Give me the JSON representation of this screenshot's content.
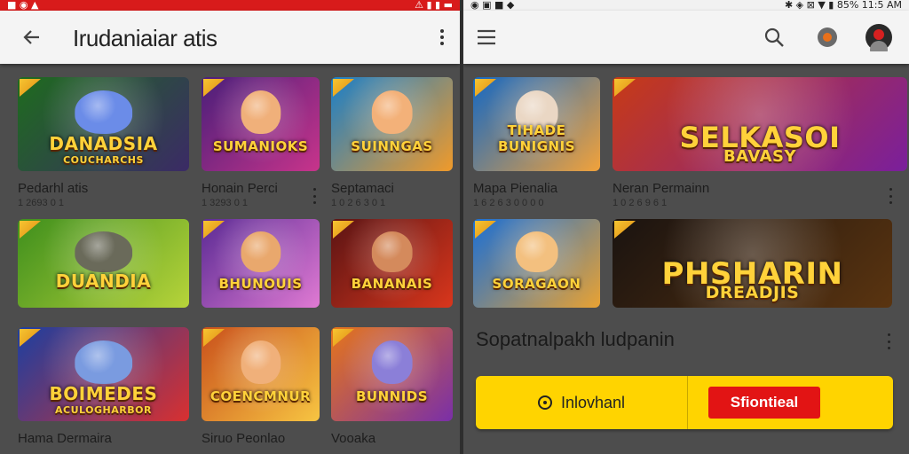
{
  "left_pane": {
    "status_bar": {
      "left": "■ ◉ ▲",
      "right": "⚠ ▮ ▮ ▬"
    },
    "app_bar": {
      "title": "Irudaniaiar atis",
      "back_icon": "arrow-left-icon",
      "more_icon": "more-vert-icon"
    },
    "grid": [
      {
        "logo": "DANADSIA",
        "tagline": "COUCHARCHS",
        "title": "Pedarhl atis",
        "sub": "1 2693 0 1",
        "colors": [
          "#1e6b1e",
          "#3b2a66"
        ],
        "face": "#6b8ce8"
      },
      {
        "logo": "SUMANIOKS",
        "title": "Honain Perci",
        "sub": "1 3293 0 1",
        "colors": [
          "#4a1f7a",
          "#c8348b"
        ],
        "face": "#f0b07a"
      },
      {
        "logo": "SUINNGAS",
        "title": "Septamaci",
        "sub": "1 0 2 6 3 0 1",
        "colors": [
          "#1a7fc9",
          "#f09a2a"
        ],
        "face": "#f3b179"
      },
      {
        "logo": "DUANDIA",
        "title": "",
        "sub": "",
        "colors": [
          "#3f8f1d",
          "#b7d43a"
        ],
        "face": "#6a6a5a"
      },
      {
        "logo": "BHUNOUIS",
        "title": "",
        "sub": "",
        "colors": [
          "#5b2b94",
          "#e07ad3"
        ],
        "face": "#e9a86d"
      },
      {
        "logo": "BANANAIS",
        "title": "",
        "sub": "",
        "colors": [
          "#5a1414",
          "#d9361c"
        ],
        "face": "#d48a5c"
      },
      {
        "logo": "BOIMEDES",
        "tagline": "ACULOGHARBOR",
        "title": "Hama Dermaira",
        "sub": "",
        "colors": [
          "#1c3fa0",
          "#d93030"
        ],
        "face": "#7a9be0"
      },
      {
        "logo": "COENCMNUR",
        "title": "Siruo Peonlao",
        "sub": "",
        "colors": [
          "#c9501c",
          "#f7c542"
        ],
        "face": "#f0b07a"
      },
      {
        "logo": "BUNNIDS",
        "title": "Vooaka",
        "sub": "",
        "colors": [
          "#e6761a",
          "#7a2fa8"
        ],
        "face": "#8b7fd8"
      }
    ]
  },
  "right_pane": {
    "status_bar": {
      "left": "◉ ▣ ■ ◆",
      "right": "✱ ◈ ⊠ ▼ ▮ 85% 11:5 AM"
    },
    "app_bar": {
      "menu_icon": "menu-icon",
      "search_icon": "search-icon",
      "notification_icon": "notification-icon",
      "avatar_icon": "avatar-icon"
    },
    "grid": [
      {
        "logo": "TIHADE BUNIGNIS",
        "title": "Mapa Pienalia",
        "sub": "1 6 2 6 3 0 0 0 0",
        "colors": [
          "#1468c4",
          "#f2a23a"
        ],
        "face": "#ead7c4"
      },
      {
        "logo": "SELKASOI",
        "tagline": "BAVASY",
        "title": "Neran Permainn",
        "sub": "1 0 2 6 9 6 1",
        "colors": [
          "#c73a16",
          "#7a1f9c"
        ],
        "face": ""
      },
      {
        "logo": "SORAGAON",
        "title": "",
        "sub": "",
        "colors": [
          "#1a6fd6",
          "#e9a232"
        ],
        "face": "#f3c07f"
      },
      {
        "logo": "PHSHARIN",
        "tagline": "DREADJIS",
        "title": "",
        "sub": "",
        "colors": [
          "#1a1310",
          "#5a3410"
        ],
        "face": ""
      }
    ],
    "section": {
      "title": "Sopatnalpakh ludpanin"
    },
    "actions": {
      "install_label": "Inlovhanl",
      "primary_label": "Sfiontieal"
    }
  }
}
